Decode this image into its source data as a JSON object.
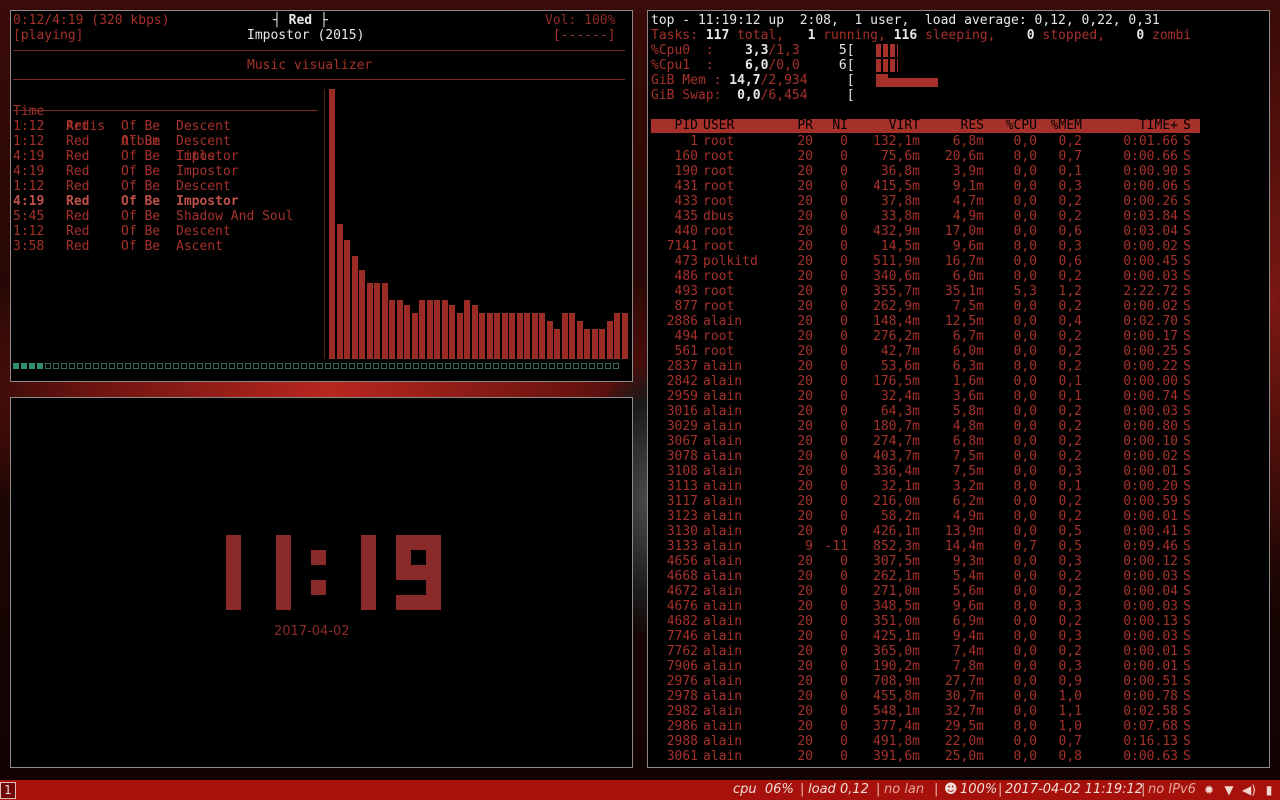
{
  "player": {
    "position": "0:12/4:19",
    "bitrate": "(320 kbps)",
    "state": "[playing]",
    "artist_header": "Red",
    "album_line": "Impostor (2015)",
    "volume": "Vol: 100%",
    "volume_bar": "[------]",
    "section_title": "Music visualizer",
    "columns": [
      "Time",
      "Artis",
      "Album",
      "Title"
    ],
    "playlist": [
      {
        "time": "1:12",
        "artist": "Red",
        "album": "Of Be",
        "title": "Descent"
      },
      {
        "time": "1:12",
        "artist": "Red",
        "album": "Of Be",
        "title": "Descent"
      },
      {
        "time": "4:19",
        "artist": "Red",
        "album": "Of Be",
        "title": "Impostor"
      },
      {
        "time": "4:19",
        "artist": "Red",
        "album": "Of Be",
        "title": "Impostor"
      },
      {
        "time": "1:12",
        "artist": "Red",
        "album": "Of Be",
        "title": "Descent"
      },
      {
        "time": "4:19",
        "artist": "Red",
        "album": "Of Be",
        "title": "Impostor",
        "current": true
      },
      {
        "time": "5:45",
        "artist": "Red",
        "album": "Of Be",
        "title": "Shadow And Soul"
      },
      {
        "time": "1:12",
        "artist": "Red",
        "album": "Of Be",
        "title": "Descent"
      },
      {
        "time": "3:58",
        "artist": "Red",
        "album": "Of Be",
        "title": "Ascent"
      }
    ],
    "visualizer_levels": [
      1.0,
      0.5,
      0.44,
      0.38,
      0.33,
      0.28,
      0.28,
      0.28,
      0.22,
      0.22,
      0.2,
      0.17,
      0.22,
      0.22,
      0.22,
      0.22,
      0.2,
      0.17,
      0.22,
      0.2,
      0.17,
      0.17,
      0.17,
      0.17,
      0.17,
      0.17,
      0.17,
      0.17,
      0.17,
      0.14,
      0.11,
      0.17,
      0.17,
      0.14,
      0.11,
      0.11,
      0.11,
      0.14,
      0.17,
      0.17
    ],
    "progress_fraction": 0.05
  },
  "clock": {
    "time": "11:19",
    "date": "2017-04-02"
  },
  "top": {
    "line1": "top - 11:19:12 up  2:08,  1 user,  load average: 0,12, 0,22, 0,31",
    "tasks": {
      "label": "Tasks:",
      "total": "117",
      "total_label": "total,",
      "running": "1",
      "running_label": "running,",
      "sleeping": "116",
      "sleeping_label": "sleeping,",
      "stopped": "0",
      "stopped_label": "stopped,",
      "zombie": "0",
      "zombie_label": "zombi"
    },
    "cpu0": {
      "label": "%Cpu0  :",
      "value": "3,3",
      "rest": "/1,3",
      "index": "5",
      "bracket": "["
    },
    "cpu1": {
      "label": "%Cpu1  :",
      "value": "6,0",
      "rest": "/0,0",
      "index": "6",
      "bracket": "["
    },
    "mem": {
      "label": "GiB Mem :",
      "value": "14,7",
      "rest": "/2,934",
      "bracket": "["
    },
    "swap": {
      "label": "GiB Swap:",
      "value": "0,0",
      "rest": "/6,454",
      "bracket": "["
    },
    "headers": [
      "PID",
      "USER",
      "PR",
      "NI",
      "VIRT",
      "RES",
      "%CPU",
      "%MEM",
      "TIME+",
      "S"
    ],
    "processes": [
      [
        "1",
        "root",
        "20",
        "0",
        "132,1m",
        "6,8m",
        "0,0",
        "0,2",
        "0:01.66",
        "S"
      ],
      [
        "160",
        "root",
        "20",
        "0",
        "75,6m",
        "20,6m",
        "0,0",
        "0,7",
        "0:00.66",
        "S"
      ],
      [
        "190",
        "root",
        "20",
        "0",
        "36,8m",
        "3,9m",
        "0,0",
        "0,1",
        "0:00.90",
        "S"
      ],
      [
        "431",
        "root",
        "20",
        "0",
        "415,5m",
        "9,1m",
        "0,0",
        "0,3",
        "0:00.06",
        "S"
      ],
      [
        "433",
        "root",
        "20",
        "0",
        "37,8m",
        "4,7m",
        "0,0",
        "0,2",
        "0:00.26",
        "S"
      ],
      [
        "435",
        "dbus",
        "20",
        "0",
        "33,8m",
        "4,9m",
        "0,0",
        "0,2",
        "0:03.84",
        "S"
      ],
      [
        "440",
        "root",
        "20",
        "0",
        "432,9m",
        "17,0m",
        "0,0",
        "0,6",
        "0:03.04",
        "S"
      ],
      [
        "7141",
        "root",
        "20",
        "0",
        "14,5m",
        "9,6m",
        "0,0",
        "0,3",
        "0:00.02",
        "S"
      ],
      [
        "473",
        "polkitd",
        "20",
        "0",
        "511,9m",
        "16,7m",
        "0,0",
        "0,6",
        "0:00.45",
        "S"
      ],
      [
        "486",
        "root",
        "20",
        "0",
        "340,6m",
        "6,0m",
        "0,0",
        "0,2",
        "0:00.03",
        "S"
      ],
      [
        "493",
        "root",
        "20",
        "0",
        "355,7m",
        "35,1m",
        "5,3",
        "1,2",
        "2:22.72",
        "S"
      ],
      [
        "877",
        "root",
        "20",
        "0",
        "262,9m",
        "7,5m",
        "0,0",
        "0,2",
        "0:00.02",
        "S"
      ],
      [
        "2886",
        "alain",
        "20",
        "0",
        "148,4m",
        "12,5m",
        "0,0",
        "0,4",
        "0:02.70",
        "S"
      ],
      [
        "494",
        "root",
        "20",
        "0",
        "276,2m",
        "6,7m",
        "0,0",
        "0,2",
        "0:00.17",
        "S"
      ],
      [
        "561",
        "root",
        "20",
        "0",
        "42,7m",
        "6,0m",
        "0,0",
        "0,2",
        "0:00.25",
        "S"
      ],
      [
        "2837",
        "alain",
        "20",
        "0",
        "53,6m",
        "6,3m",
        "0,0",
        "0,2",
        "0:00.22",
        "S"
      ],
      [
        "2842",
        "alain",
        "20",
        "0",
        "176,5m",
        "1,6m",
        "0,0",
        "0,1",
        "0:00.00",
        "S"
      ],
      [
        "2959",
        "alain",
        "20",
        "0",
        "32,4m",
        "3,6m",
        "0,0",
        "0,1",
        "0:00.74",
        "S"
      ],
      [
        "3016",
        "alain",
        "20",
        "0",
        "64,3m",
        "5,8m",
        "0,0",
        "0,2",
        "0:00.03",
        "S"
      ],
      [
        "3029",
        "alain",
        "20",
        "0",
        "180,7m",
        "4,8m",
        "0,0",
        "0,2",
        "0:00.80",
        "S"
      ],
      [
        "3067",
        "alain",
        "20",
        "0",
        "274,7m",
        "6,8m",
        "0,0",
        "0,2",
        "0:00.10",
        "S"
      ],
      [
        "3078",
        "alain",
        "20",
        "0",
        "403,7m",
        "7,5m",
        "0,0",
        "0,2",
        "0:00.02",
        "S"
      ],
      [
        "3108",
        "alain",
        "20",
        "0",
        "336,4m",
        "7,5m",
        "0,0",
        "0,3",
        "0:00.01",
        "S"
      ],
      [
        "3113",
        "alain",
        "20",
        "0",
        "32,1m",
        "3,2m",
        "0,0",
        "0,1",
        "0:00.20",
        "S"
      ],
      [
        "3117",
        "alain",
        "20",
        "0",
        "216,0m",
        "6,2m",
        "0,0",
        "0,2",
        "0:00.59",
        "S"
      ],
      [
        "3123",
        "alain",
        "20",
        "0",
        "58,2m",
        "4,9m",
        "0,0",
        "0,2",
        "0:00.01",
        "S"
      ],
      [
        "3130",
        "alain",
        "20",
        "0",
        "426,1m",
        "13,9m",
        "0,0",
        "0,5",
        "0:00.41",
        "S"
      ],
      [
        "3133",
        "alain",
        "9",
        "-11",
        "852,3m",
        "14,4m",
        "0,7",
        "0,5",
        "0:09.46",
        "S"
      ],
      [
        "4656",
        "alain",
        "20",
        "0",
        "307,5m",
        "9,3m",
        "0,0",
        "0,3",
        "0:00.12",
        "S"
      ],
      [
        "4668",
        "alain",
        "20",
        "0",
        "262,1m",
        "5,4m",
        "0,0",
        "0,2",
        "0:00.03",
        "S"
      ],
      [
        "4672",
        "alain",
        "20",
        "0",
        "271,0m",
        "5,6m",
        "0,0",
        "0,2",
        "0:00.04",
        "S"
      ],
      [
        "4676",
        "alain",
        "20",
        "0",
        "348,5m",
        "9,6m",
        "0,0",
        "0,3",
        "0:00.03",
        "S"
      ],
      [
        "4682",
        "alain",
        "20",
        "0",
        "351,0m",
        "6,9m",
        "0,0",
        "0,2",
        "0:00.13",
        "S"
      ],
      [
        "7746",
        "alain",
        "20",
        "0",
        "425,1m",
        "9,4m",
        "0,0",
        "0,3",
        "0:00.03",
        "S"
      ],
      [
        "7762",
        "alain",
        "20",
        "0",
        "365,0m",
        "7,4m",
        "0,0",
        "0,2",
        "0:00.01",
        "S"
      ],
      [
        "7906",
        "alain",
        "20",
        "0",
        "190,2m",
        "7,8m",
        "0,0",
        "0,3",
        "0:00.01",
        "S"
      ],
      [
        "2976",
        "alain",
        "20",
        "0",
        "708,9m",
        "27,7m",
        "0,0",
        "0,9",
        "0:00.51",
        "S"
      ],
      [
        "2978",
        "alain",
        "20",
        "0",
        "455,8m",
        "30,7m",
        "0,0",
        "1,0",
        "0:00.78",
        "S"
      ],
      [
        "2982",
        "alain",
        "20",
        "0",
        "548,1m",
        "32,7m",
        "0,0",
        "1,1",
        "0:02.58",
        "S"
      ],
      [
        "2986",
        "alain",
        "20",
        "0",
        "377,4m",
        "29,5m",
        "0,0",
        "1,0",
        "0:07.68",
        "S"
      ],
      [
        "2988",
        "alain",
        "20",
        "0",
        "491,8m",
        "22,0m",
        "0,0",
        "0,7",
        "0:16.13",
        "S"
      ],
      [
        "3061",
        "alain",
        "20",
        "0",
        "391,6m",
        "25,0m",
        "0,0",
        "0,8",
        "0:00.63",
        "S"
      ]
    ]
  },
  "statusbar": {
    "workspace": "1",
    "cpu_label": "cpu",
    "cpu_value": "06%",
    "load_label": "load",
    "load_value": "0,12",
    "lan": "no lan",
    "battery": "100%",
    "datetime": "2017-04-02 11:19:12",
    "ipv6": "no IPv6",
    "colors": {
      "bar": "#a6110c",
      "accent": "#a6312a",
      "progress": "#2f8f6e"
    }
  }
}
